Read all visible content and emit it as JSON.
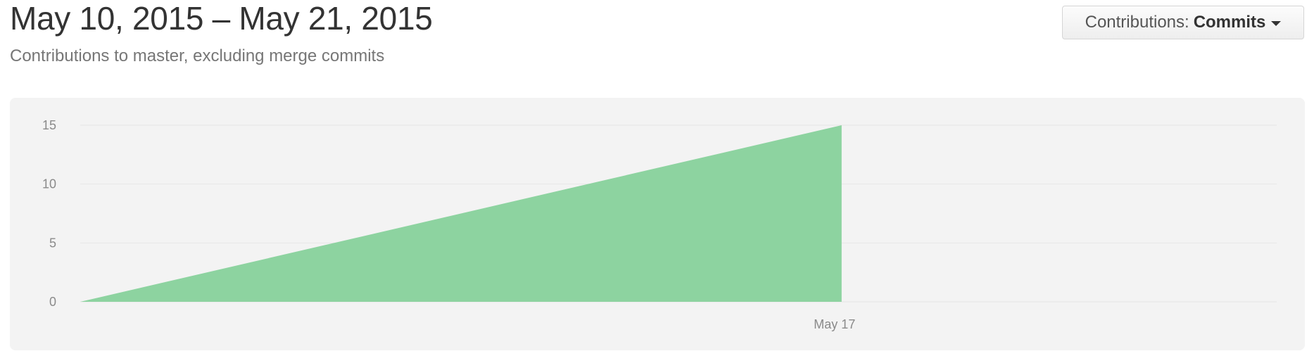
{
  "header": {
    "title": "May 10, 2015 – May 21, 2015",
    "subtitle": "Contributions to master, excluding merge commits"
  },
  "contributions_select": {
    "prefix": "Contributions:",
    "value": "Commits",
    "icon": "caret-down-icon"
  },
  "colors": {
    "area_fill": "#8dd3a0",
    "panel_bg": "#f3f3f3",
    "gridline": "#e6e6e6"
  },
  "chart_data": {
    "type": "area",
    "x": [
      "2015-05-10",
      "2015-05-17"
    ],
    "values": [
      0,
      15
    ],
    "xlim": [
      "2015-05-10",
      "2015-05-21"
    ],
    "ylim": [
      0,
      15
    ],
    "y_ticks": [
      0,
      5,
      10,
      15
    ],
    "x_ticks": [
      {
        "date": "2015-05-17",
        "label": "May 17"
      }
    ],
    "grid": true,
    "legend": "none"
  }
}
